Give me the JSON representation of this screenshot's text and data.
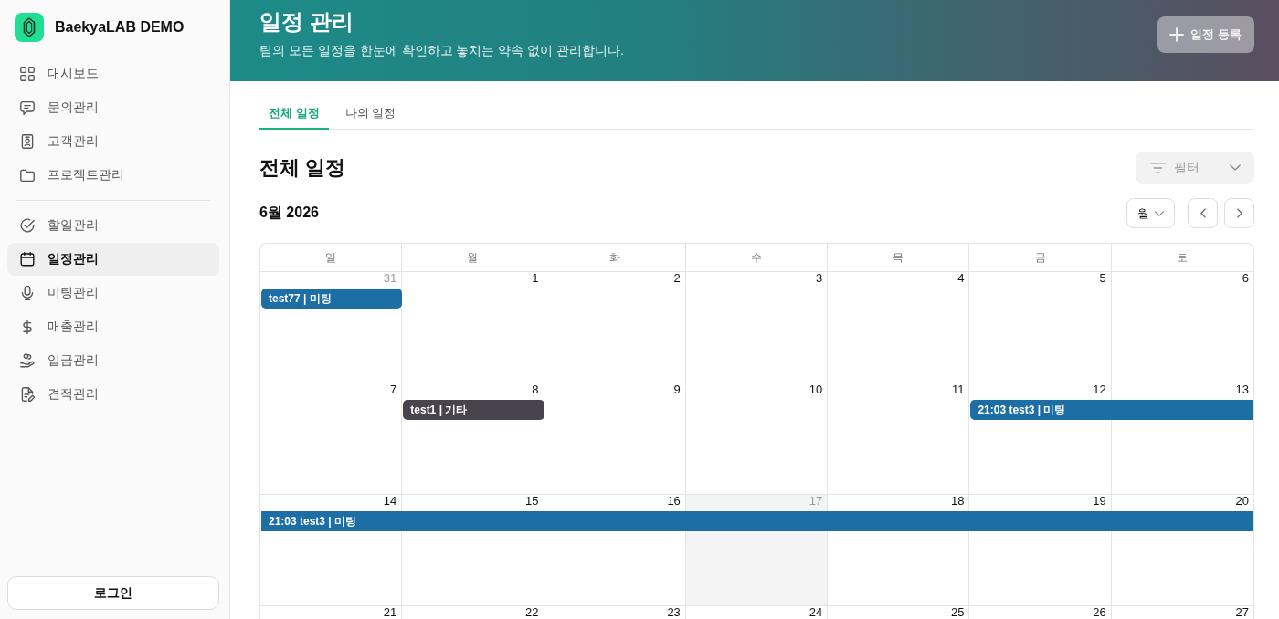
{
  "sidebar": {
    "brand": "BaekyaLAB DEMO",
    "sections": [
      {
        "items": [
          {
            "label": "대시보드",
            "selected": false
          },
          {
            "label": "문의관리",
            "selected": false
          },
          {
            "label": "고객관리",
            "selected": false
          },
          {
            "label": "프로젝트관리",
            "selected": false
          }
        ]
      },
      {
        "items": [
          {
            "label": "할일관리",
            "selected": false
          },
          {
            "label": "일정관리",
            "selected": true
          },
          {
            "label": "미팅관리",
            "selected": false
          },
          {
            "label": "매출관리",
            "selected": false
          },
          {
            "label": "입금관리",
            "selected": false
          },
          {
            "label": "견적관리",
            "selected": false
          }
        ]
      }
    ],
    "login_button": "로그인"
  },
  "header": {
    "title": "일정 관리",
    "subtitle": "팀의 모든 일정을 한눈에 확인하고 놓치는 약속 없이 관리합니다.",
    "add_button": {
      "label": "일정 등록",
      "disabled": true
    }
  },
  "tabs": [
    {
      "label": "전체 일정",
      "selected": true
    },
    {
      "label": "나의 일정",
      "selected": false
    }
  ],
  "section_title": "전체 일정",
  "filter": {
    "label": "필터",
    "disabled": true
  },
  "calendar": {
    "month_label": "6월 2026",
    "view_select": "월",
    "weekdays": [
      "일",
      "월",
      "화",
      "수",
      "목",
      "금",
      "토"
    ],
    "weeks": [
      {
        "days": [
          {
            "date": "31",
            "outside_month": true,
            "today": false,
            "events": [
              {
                "label": "test77 | 미팅",
                "color": "#1c6ea4",
                "to_week_end": false,
                "continued": false,
                "continues": false
              }
            ]
          },
          {
            "date": "1",
            "outside_month": false,
            "today": false
          },
          {
            "date": "2",
            "outside_month": false,
            "today": false
          },
          {
            "date": "3",
            "outside_month": false,
            "today": false
          },
          {
            "date": "4",
            "outside_month": false,
            "today": false
          },
          {
            "date": "5",
            "outside_month": false,
            "today": false
          },
          {
            "date": "6",
            "outside_month": false,
            "today": false
          }
        ]
      },
      {
        "days": [
          {
            "date": "7",
            "outside_month": false,
            "today": false
          },
          {
            "date": "8",
            "outside_month": false,
            "today": false,
            "events": [
              {
                "label": "test1 | 기타",
                "color": "#48444d",
                "to_week_end": false,
                "continued": false,
                "continues": false
              }
            ]
          },
          {
            "date": "9",
            "outside_month": false,
            "today": false
          },
          {
            "date": "10",
            "outside_month": false,
            "today": false
          },
          {
            "date": "11",
            "outside_month": false,
            "today": false
          },
          {
            "date": "12",
            "outside_month": false,
            "today": false,
            "events": [
              {
                "label": "21:03 test3 | 미팅",
                "color": "#1c6ea4",
                "to_week_end": true,
                "continued": false,
                "continues": true
              }
            ]
          },
          {
            "date": "13",
            "outside_month": false,
            "today": false
          }
        ]
      },
      {
        "days": [
          {
            "date": "14",
            "outside_month": false,
            "today": false,
            "events": [
              {
                "label": "21:03 test3 | 미팅",
                "color": "#1c6ea4",
                "to_week_end": true,
                "continued": true,
                "continues": true
              }
            ]
          },
          {
            "date": "15",
            "outside_month": false,
            "today": false
          },
          {
            "date": "16",
            "outside_month": false,
            "today": false
          },
          {
            "date": "17",
            "outside_month": false,
            "today": true
          },
          {
            "date": "18",
            "outside_month": false,
            "today": false
          },
          {
            "date": "19",
            "outside_month": false,
            "today": false
          },
          {
            "date": "20",
            "outside_month": false,
            "today": false
          }
        ]
      },
      {
        "days": [
          {
            "date": "21",
            "outside_month": false,
            "today": false
          },
          {
            "date": "22",
            "outside_month": false,
            "today": false
          },
          {
            "date": "23",
            "outside_month": false,
            "today": false
          },
          {
            "date": "24",
            "outside_month": false,
            "today": false
          },
          {
            "date": "25",
            "outside_month": false,
            "today": false
          },
          {
            "date": "26",
            "outside_month": false,
            "today": false
          },
          {
            "date": "27",
            "outside_month": false,
            "today": false
          }
        ]
      }
    ]
  }
}
